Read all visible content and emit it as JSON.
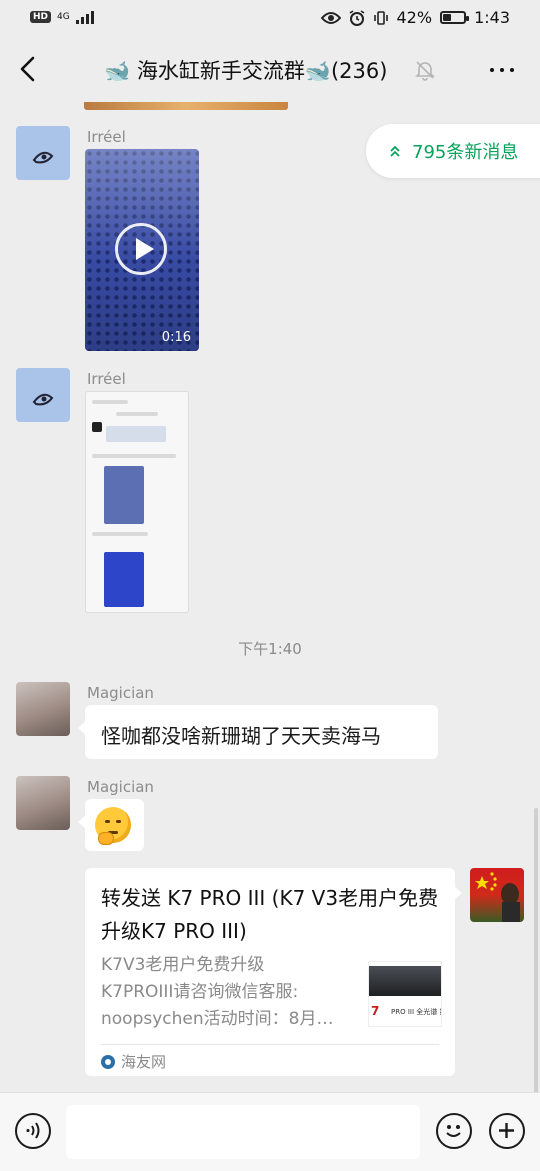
{
  "status_bar": {
    "hd": "HD",
    "network": "4G",
    "battery_level": 0.42,
    "battery_text": "42%",
    "time": "1:43"
  },
  "header": {
    "title": "🐋 海水缸新手交流群🐋(236)"
  },
  "new_messages_badge": "795条新消息",
  "messages": [
    {
      "sender": "Irréel",
      "type": "video",
      "duration": "0:16"
    },
    {
      "sender": "Irréel",
      "type": "image"
    },
    {
      "type": "timestamp",
      "text": "下午1:40"
    },
    {
      "sender": "Magician",
      "type": "text",
      "text": "怪咖都没啥新珊瑚了天天卖海马"
    },
    {
      "sender": "Magician",
      "type": "emoji"
    },
    {
      "type": "link_card",
      "outgoing": true,
      "title": "转发送 K7 PRO III (K7 V3老用户免费升级K7 PRO III)",
      "desc_lines": [
        "K7V3老用户免费升级",
        "K7PROIII请咨询微信客服:",
        "noopsychen活动时间：8月…"
      ],
      "source": "海友网",
      "thumb": {
        "brand": "7",
        "line1": "PRO III",
        "line2": "全光谱 数据导入导出"
      }
    }
  ],
  "colors": {
    "background": "#ededed",
    "accent_green": "#07a35a",
    "bubble": "#ffffff"
  },
  "icons": {
    "back": "chevron-left-icon",
    "mute": "bell-off-icon",
    "more": "more-horizontal-icon",
    "voice": "voice-icon",
    "emoji": "emoji-icon",
    "plus": "plus-icon"
  }
}
